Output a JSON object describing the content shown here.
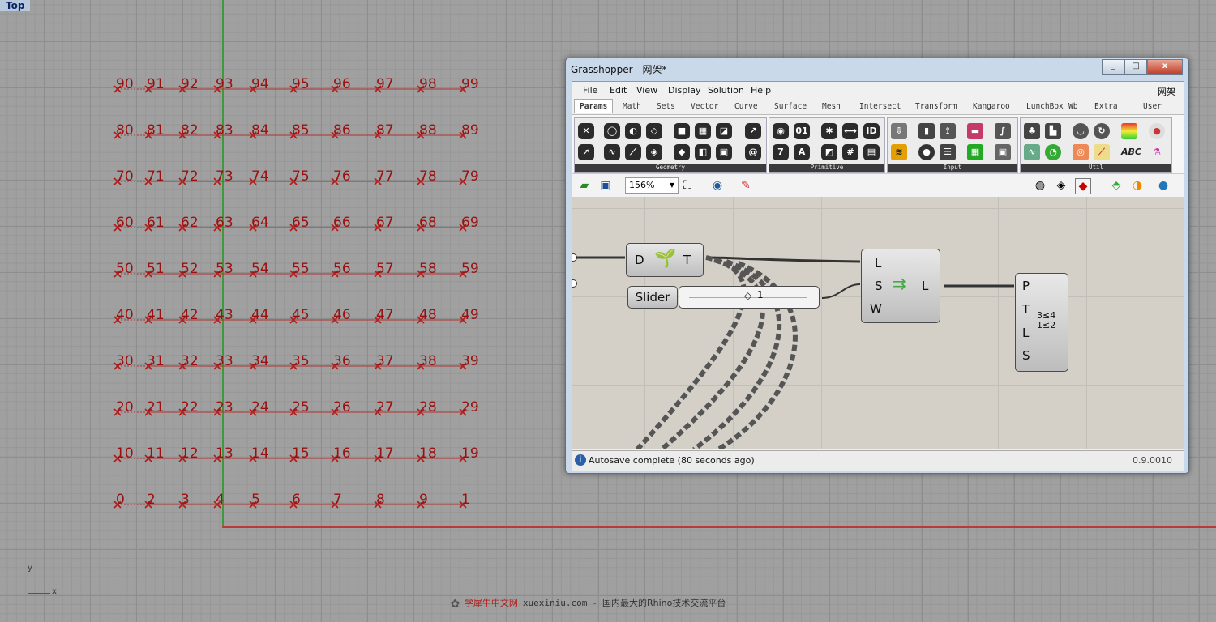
{
  "viewport": {
    "label": "Top",
    "grid_rows": [
      [
        "90",
        "91",
        "92",
        "93",
        "94",
        "95",
        "96",
        "97",
        "98",
        "99"
      ],
      [
        "80",
        "81",
        "82",
        "83",
        "84",
        "85",
        "86",
        "87",
        "88",
        "89"
      ],
      [
        "70",
        "71",
        "72",
        "73",
        "74",
        "75",
        "76",
        "77",
        "78",
        "79"
      ],
      [
        "60",
        "61",
        "62",
        "63",
        "64",
        "65",
        "66",
        "67",
        "68",
        "69"
      ],
      [
        "50",
        "51",
        "52",
        "53",
        "54",
        "55",
        "56",
        "57",
        "58",
        "59"
      ],
      [
        "40",
        "41",
        "42",
        "43",
        "44",
        "45",
        "46",
        "47",
        "48",
        "49"
      ],
      [
        "30",
        "31",
        "32",
        "33",
        "34",
        "35",
        "36",
        "37",
        "38",
        "39"
      ],
      [
        "20",
        "21",
        "22",
        "23",
        "24",
        "25",
        "26",
        "27",
        "28",
        "29"
      ],
      [
        "10",
        "11",
        "12",
        "13",
        "14",
        "15",
        "16",
        "17",
        "18",
        "19"
      ],
      [
        "0",
        "2",
        "3",
        "4",
        "5",
        "6",
        "7",
        "8",
        "9",
        "1"
      ]
    ],
    "axis_y": "y",
    "axis_x": "x",
    "colors": {
      "points": "#9a1010",
      "x_axis": "#b83a3a",
      "y_axis": "#3c9a3c"
    }
  },
  "watermark": {
    "cn": "学犀牛中文网",
    "url": "xuexiniu.com",
    "sep": "-",
    "tagline": "国内最大的Rhino技术交流平台"
  },
  "grasshopper": {
    "title": "Grasshopper - 网架*",
    "window_buttons": [
      "_",
      "□",
      "x"
    ],
    "menu": [
      "File",
      "Edit",
      "View",
      "Display",
      "Solution",
      "Help"
    ],
    "menu_right": "网架",
    "tabs": [
      "Params",
      "Math",
      "Sets",
      "Vector",
      "Curve",
      "Surface",
      "Mesh",
      "Intersect",
      "Transform",
      "Kangaroo",
      "LunchBox",
      "Wb",
      "Extra",
      "User"
    ],
    "active_tab": "Params",
    "groups": [
      "Geometry",
      "Primitive",
      "Input",
      "Util"
    ],
    "zoom": "156%",
    "components": {
      "data_in": "D",
      "data_out": "T",
      "slider_label": "Slider",
      "slider_value": "1",
      "list_item_inputs": [
        "L",
        "S",
        "W"
      ],
      "list_item_output": "L",
      "panel_inputs": [
        "P",
        "T",
        "L",
        "S"
      ],
      "panel_icon_text": "3≤4 1≤2"
    },
    "status": "Autosave complete (80 seconds ago)",
    "version": "0.9.0010"
  }
}
